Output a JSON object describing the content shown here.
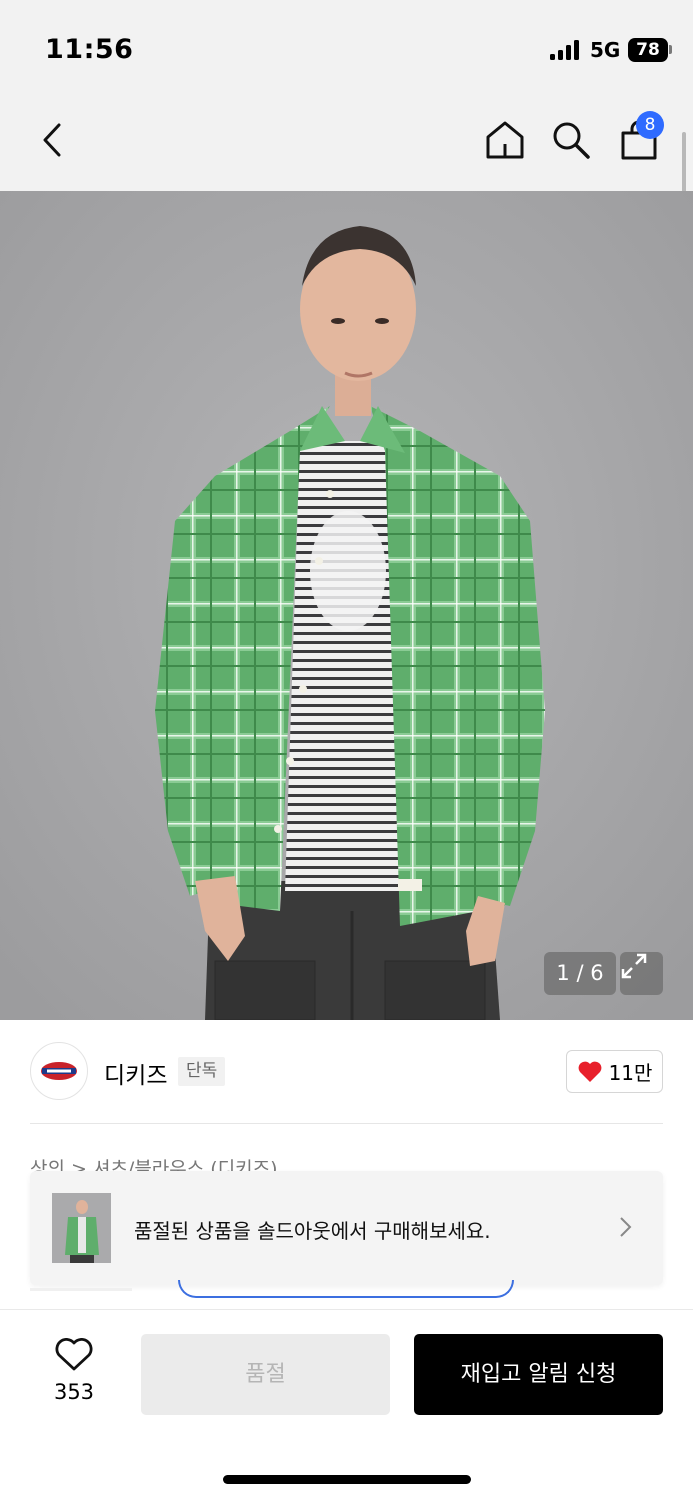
{
  "status_bar": {
    "time": "11:56",
    "network": "5G",
    "battery": "78"
  },
  "nav": {
    "cart_count": "8",
    "icons": [
      "back-arrow-icon",
      "home-icon",
      "search-icon",
      "shopping-bag-icon"
    ]
  },
  "colors": {
    "accent_blue": "#2f6bff",
    "like_red": "#e8202b",
    "restock_button": "#000000",
    "soldout_button": "#ebebeb"
  },
  "gallery": {
    "pager": "1 / 6",
    "current_index": 1,
    "total": 6
  },
  "brand": {
    "name": "디키즈",
    "tag": "단독",
    "likes": "11만"
  },
  "breadcrumb": "상의 > 셔츠/블라우스 (디키즈)",
  "banner": {
    "text": "품절된 상품을 솔드아웃에서 구매해보세요."
  },
  "bottom_bar": {
    "wish_count": "353",
    "soldout_label": "품절",
    "restock_label": "재입고 알림 신청"
  }
}
